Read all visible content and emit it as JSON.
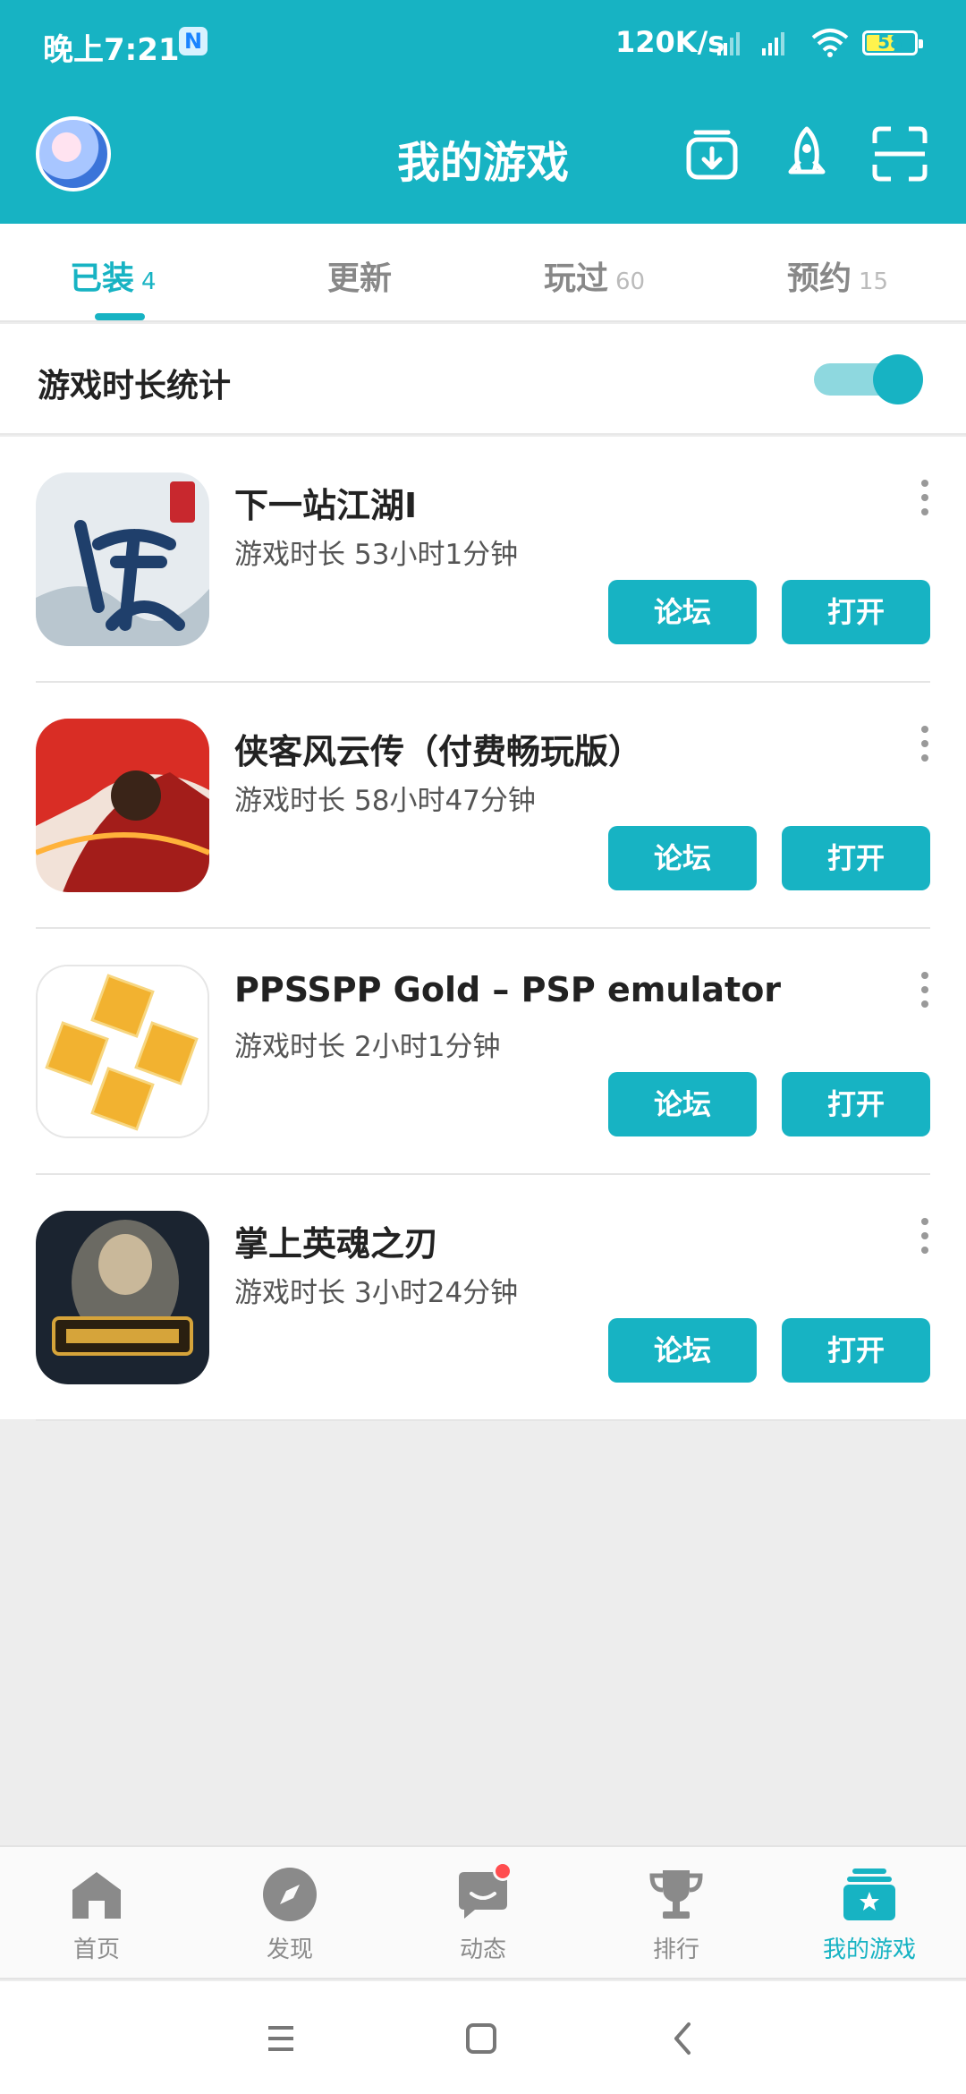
{
  "status_bar": {
    "time": "晚上7:21",
    "app_badge": "N",
    "network_speed": "120K/s",
    "battery": "58"
  },
  "header": {
    "title": "我的游戏"
  },
  "tabs": [
    {
      "label": "已装",
      "count": "4",
      "active": true
    },
    {
      "label": "更新",
      "count": "",
      "active": false
    },
    {
      "label": "玩过",
      "count": "60",
      "active": false
    },
    {
      "label": "预约",
      "count": "15",
      "active": false
    }
  ],
  "stats": {
    "label": "游戏时长统计",
    "enabled": true
  },
  "games": [
    {
      "name": "下一站江湖Ⅰ",
      "duration_label": "游戏时长",
      "duration": "53小时1分钟",
      "forum": "论坛",
      "open": "打开"
    },
    {
      "name": "侠客风云传（付费畅玩版）",
      "duration_label": "游戏时长",
      "duration": "58小时47分钟",
      "forum": "论坛",
      "open": "打开"
    },
    {
      "name": "PPSSPP Gold – PSP emulator",
      "duration_label": "游戏时长",
      "duration": "2小时1分钟",
      "forum": "论坛",
      "open": "打开"
    },
    {
      "name": "掌上英魂之刃",
      "duration_label": "游戏时长",
      "duration": "3小时24分钟",
      "forum": "论坛",
      "open": "打开"
    }
  ],
  "bottom_nav": [
    {
      "label": "首页",
      "icon": "home-icon",
      "active": false
    },
    {
      "label": "发现",
      "icon": "compass-icon",
      "active": false
    },
    {
      "label": "动态",
      "icon": "chat-icon",
      "active": false
    },
    {
      "label": "排行",
      "icon": "trophy-icon",
      "active": false
    },
    {
      "label": "我的游戏",
      "icon": "my-games-icon",
      "active": true
    }
  ],
  "colors": {
    "accent": "#17b3c3",
    "background": "#ededed",
    "badge": "#ff4d4f"
  }
}
